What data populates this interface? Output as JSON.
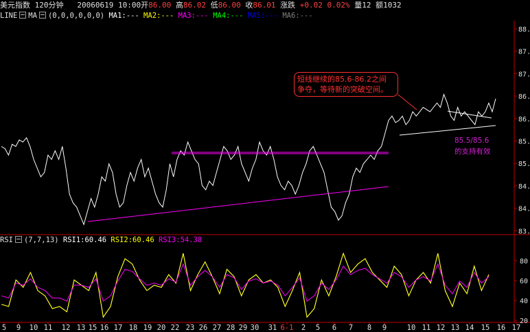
{
  "header": {
    "symbol": "美元指数",
    "period": "120分钟",
    "datetime": "20060619 10:00",
    "open_label": "开",
    "open": "86.00",
    "high_label": "高",
    "high": "86.02",
    "low_label": "低",
    "low": "86.00",
    "close_label": "收",
    "close": "86.01",
    "change_label": "涨跌",
    "change": "+0.02",
    "change_pct": "0.02%",
    "volume_label": "量",
    "volume": "12",
    "amount_label": "额",
    "amount": "1032"
  },
  "ma_legend": {
    "type": "LINE",
    "name": "MA",
    "params": "(0,0,0,0,0,0)",
    "items": [
      {
        "label": "MA1:---",
        "color": "#ffffff"
      },
      {
        "label": "MA2:---",
        "color": "#ffff00"
      },
      {
        "label": "MA3:---",
        "color": "#ff00ff"
      },
      {
        "label": "MA4:---",
        "color": "#00ff00"
      },
      {
        "label": "MA5:---",
        "color": "#0000ff"
      },
      {
        "label": "MA6:---",
        "color": "#808080"
      }
    ]
  },
  "rsi_legend": {
    "name": "RSI",
    "params": "(7,7,13)",
    "items": [
      {
        "label": "RSI1:60.46",
        "color": "#ffffff"
      },
      {
        "label": "RSI2:60.46",
        "color": "#ffff00"
      },
      {
        "label": "RSI3:54.38",
        "color": "#ff00ff"
      }
    ]
  },
  "annotation": {
    "line1": "短线继续的85.6-86.2之间",
    "line2": "争夺，等待新的突破空间。"
  },
  "support_note": {
    "line1": "85.5/85.6",
    "line2": "的支持有效"
  },
  "colors": {
    "price": "#ffffff",
    "trendline": "#ff00ff",
    "rsi1": "#ffffff",
    "rsi2": "#ffff00",
    "rsi3": "#ff00ff",
    "axis": "#c00000",
    "label": "#e0e0e0"
  },
  "chart_data": [
    {
      "type": "line",
      "title": "美元指数 120分钟",
      "y_ticks": [
        "88.",
        "87.",
        "87.",
        "86.",
        "86.",
        "85.",
        "85.",
        "84.",
        "84.",
        "83."
      ],
      "ylim": [
        83.3,
        88.2
      ],
      "series": [
        {
          "name": "price",
          "values": [
            85.3,
            85.25,
            85.1,
            85.35,
            85.3,
            85.45,
            85.4,
            85.5,
            85.3,
            85.0,
            84.8,
            84.6,
            84.7,
            85.1,
            85.0,
            85.2,
            85.0,
            85.3,
            84.8,
            84.2,
            84.0,
            83.9,
            83.7,
            83.5,
            83.8,
            84.1,
            83.9,
            84.2,
            84.6,
            84.5,
            84.9,
            84.7,
            84.2,
            83.9,
            84.0,
            84.4,
            84.7,
            84.5,
            84.8,
            85.0,
            84.6,
            84.8,
            84.5,
            84.2,
            84.0,
            83.9,
            84.3,
            84.9,
            84.6,
            85.0,
            85.2,
            85.1,
            85.4,
            85.2,
            85.0,
            84.9,
            84.4,
            84.3,
            84.5,
            84.4,
            84.7,
            85.0,
            85.3,
            85.2,
            85.0,
            85.1,
            85.3,
            84.9,
            84.7,
            84.5,
            84.8,
            85.0,
            85.4,
            85.2,
            85.1,
            85.3,
            85.0,
            84.6,
            84.4,
            84.3,
            84.5,
            84.4,
            84.2,
            84.4,
            84.7,
            84.9,
            85.2,
            85.3,
            85.1,
            84.9,
            84.7,
            84.3,
            83.9,
            83.8,
            83.6,
            83.7,
            84.0,
            84.2,
            84.6,
            84.8,
            84.7,
            84.9,
            85.0,
            85.1,
            85.0,
            85.2,
            85.3,
            85.6,
            85.9,
            86.0,
            85.85,
            85.9,
            86.0,
            85.8,
            85.9,
            86.1,
            86.0,
            86.1,
            86.2,
            86.15,
            86.1,
            86.2,
            86.3,
            86.2,
            86.5,
            86.3,
            86.0,
            85.9,
            86.2,
            86.0,
            86.1,
            86.0,
            85.9,
            85.8,
            86.1,
            86.0,
            86.1,
            86.3,
            86.1,
            86.4
          ]
        }
      ]
    },
    {
      "type": "line",
      "title": "RSI(7,7,13)",
      "y_ticks": [
        "80",
        "60",
        "40",
        "20"
      ],
      "ylim": [
        15,
        88
      ],
      "x_tick_labels": [
        "5",
        "9",
        "10",
        "11",
        "12",
        "13",
        "15",
        "16",
        "17",
        "18",
        "19",
        "20",
        "22",
        "23",
        "26",
        "27",
        "28",
        "29",
        "30",
        "31",
        "6-1",
        "2",
        "5",
        "6",
        "7",
        "8",
        "9",
        "10",
        "11",
        "12",
        "13",
        "14",
        "15",
        "16",
        "17"
      ],
      "series": [
        {
          "name": "RSI1",
          "values": [
            32,
            30,
            55,
            48,
            62,
            45,
            40,
            28,
            30,
            25,
            55,
            50,
            45,
            62,
            20,
            30,
            58,
            75,
            70,
            55,
            45,
            50,
            48,
            60,
            52,
            80,
            45,
            60,
            72,
            58,
            42,
            65,
            58,
            40,
            55,
            60,
            52,
            55,
            48,
            30,
            45,
            62,
            20,
            28,
            55,
            40,
            58,
            80,
            62,
            70,
            75,
            62,
            55,
            48,
            68,
            60,
            40,
            55,
            62,
            52,
            80,
            45,
            30,
            52,
            42,
            68,
            45,
            60
          ]
        },
        {
          "name": "RSI2",
          "values": [
            32,
            30,
            55,
            48,
            62,
            45,
            40,
            28,
            30,
            25,
            55,
            50,
            45,
            62,
            20,
            30,
            58,
            75,
            70,
            55,
            45,
            50,
            48,
            60,
            52,
            80,
            45,
            60,
            72,
            58,
            42,
            65,
            58,
            40,
            55,
            60,
            52,
            55,
            48,
            30,
            45,
            62,
            20,
            28,
            55,
            40,
            58,
            80,
            62,
            70,
            75,
            62,
            55,
            48,
            68,
            60,
            40,
            55,
            62,
            52,
            80,
            45,
            30,
            52,
            42,
            68,
            45,
            60
          ]
        },
        {
          "name": "RSI3",
          "values": [
            40,
            38,
            52,
            50,
            56,
            48,
            45,
            38,
            38,
            35,
            50,
            50,
            48,
            56,
            35,
            40,
            54,
            65,
            63,
            56,
            50,
            52,
            50,
            56,
            53,
            70,
            50,
            58,
            64,
            58,
            48,
            60,
            57,
            46,
            54,
            56,
            52,
            54,
            50,
            40,
            48,
            57,
            35,
            40,
            52,
            46,
            55,
            68,
            60,
            64,
            66,
            60,
            56,
            52,
            62,
            58,
            48,
            55,
            58,
            54,
            70,
            50,
            42,
            54,
            48,
            62,
            52,
            58
          ]
        }
      ]
    }
  ]
}
